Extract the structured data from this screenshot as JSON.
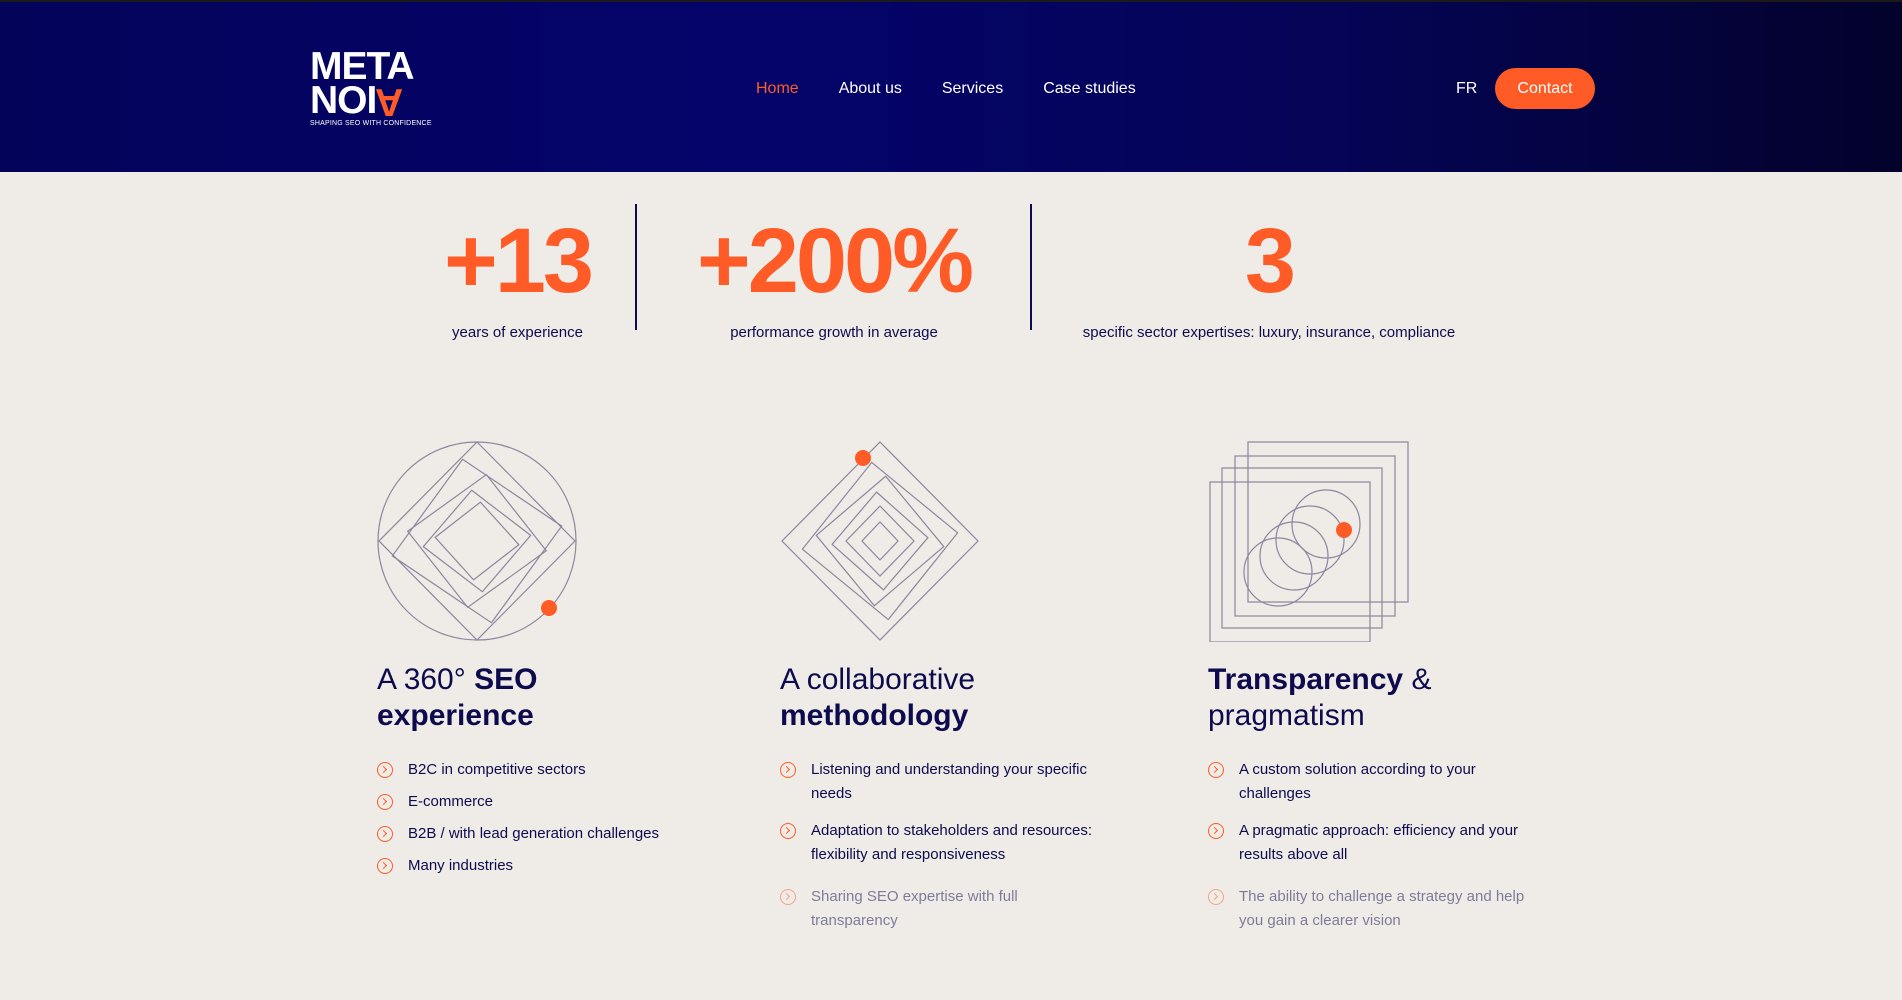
{
  "brand": {
    "logo_line1": "META",
    "logo_line2_prefix": "NOI",
    "logo_line2_accent": "A",
    "tagline": "SHAPING SEO WITH CONFIDENCE",
    "accent_color": "#ff5b27",
    "navy_color": "#0d0b4d"
  },
  "nav": {
    "items": [
      {
        "label": "Home",
        "active": true
      },
      {
        "label": "About us",
        "active": false
      },
      {
        "label": "Services",
        "active": false
      },
      {
        "label": "Case studies",
        "active": false
      }
    ],
    "lang": "FR",
    "contact_label": "Contact"
  },
  "stats": [
    {
      "value": "+13",
      "label": "years of experience"
    },
    {
      "value": "+200%",
      "label": "performance growth in average"
    },
    {
      "value": "3",
      "label": "specific sector expertises: luxury, insurance, compliance"
    }
  ],
  "columns": [
    {
      "title_plain": "A 360° ",
      "title_bold": "SEO",
      "title_bold2": "experience",
      "icon": "concentric-diamonds-in-circle-icon",
      "items": [
        "B2C in competitive sectors",
        "E-commerce",
        "B2B / with lead generation challenges",
        "Many industries"
      ]
    },
    {
      "title_plain": "A collaborative",
      "title_bold": "methodology",
      "icon": "nested-diamonds-icon",
      "items": [
        "Listening and understanding your specific needs",
        "Adaptation to stakeholders and resources: flexibility and responsiveness",
        "Sharing SEO expertise with full transparency"
      ]
    },
    {
      "title_bold": "Transparency",
      "title_plain": " &",
      "title_plain2": "pragmatism",
      "icon": "overlapping-squares-circles-icon",
      "items": [
        "A custom solution according to your challenges",
        "A pragmatic approach: efficiency and your results above all",
        "The ability to challenge a strategy and help you gain a clearer vision"
      ]
    }
  ]
}
